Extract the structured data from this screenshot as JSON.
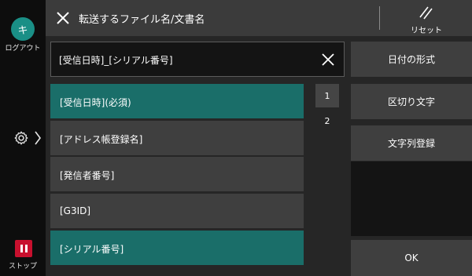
{
  "sidebar": {
    "logout_glyph": "キ",
    "logout_label": "ログアウト",
    "settings_icon": "gear-icon",
    "stop_label": "ストップ"
  },
  "header": {
    "title": "転送するファイル名/文書名",
    "reset_label": "リセット"
  },
  "filename_field": {
    "value": "[受信日時]_[シリアル番号]"
  },
  "tokens": [
    {
      "label": "[受信日時](必須)",
      "selected": true
    },
    {
      "label": "[アドレス帳登録名]",
      "selected": false
    },
    {
      "label": "[発信者番号]",
      "selected": false
    },
    {
      "label": "[G3ID]",
      "selected": false
    },
    {
      "label": "[シリアル番号]",
      "selected": true
    }
  ],
  "pager": {
    "pages": [
      "1",
      "2"
    ],
    "current": "1"
  },
  "side_buttons": {
    "date_format": "日付の形式",
    "separator": "区切り文字",
    "register_string": "文字列登録",
    "ok": "OK"
  },
  "colors": {
    "accent_teal": "#1a6e69",
    "logout_teal": "#1a8f86",
    "stop_red": "#c8102e"
  }
}
